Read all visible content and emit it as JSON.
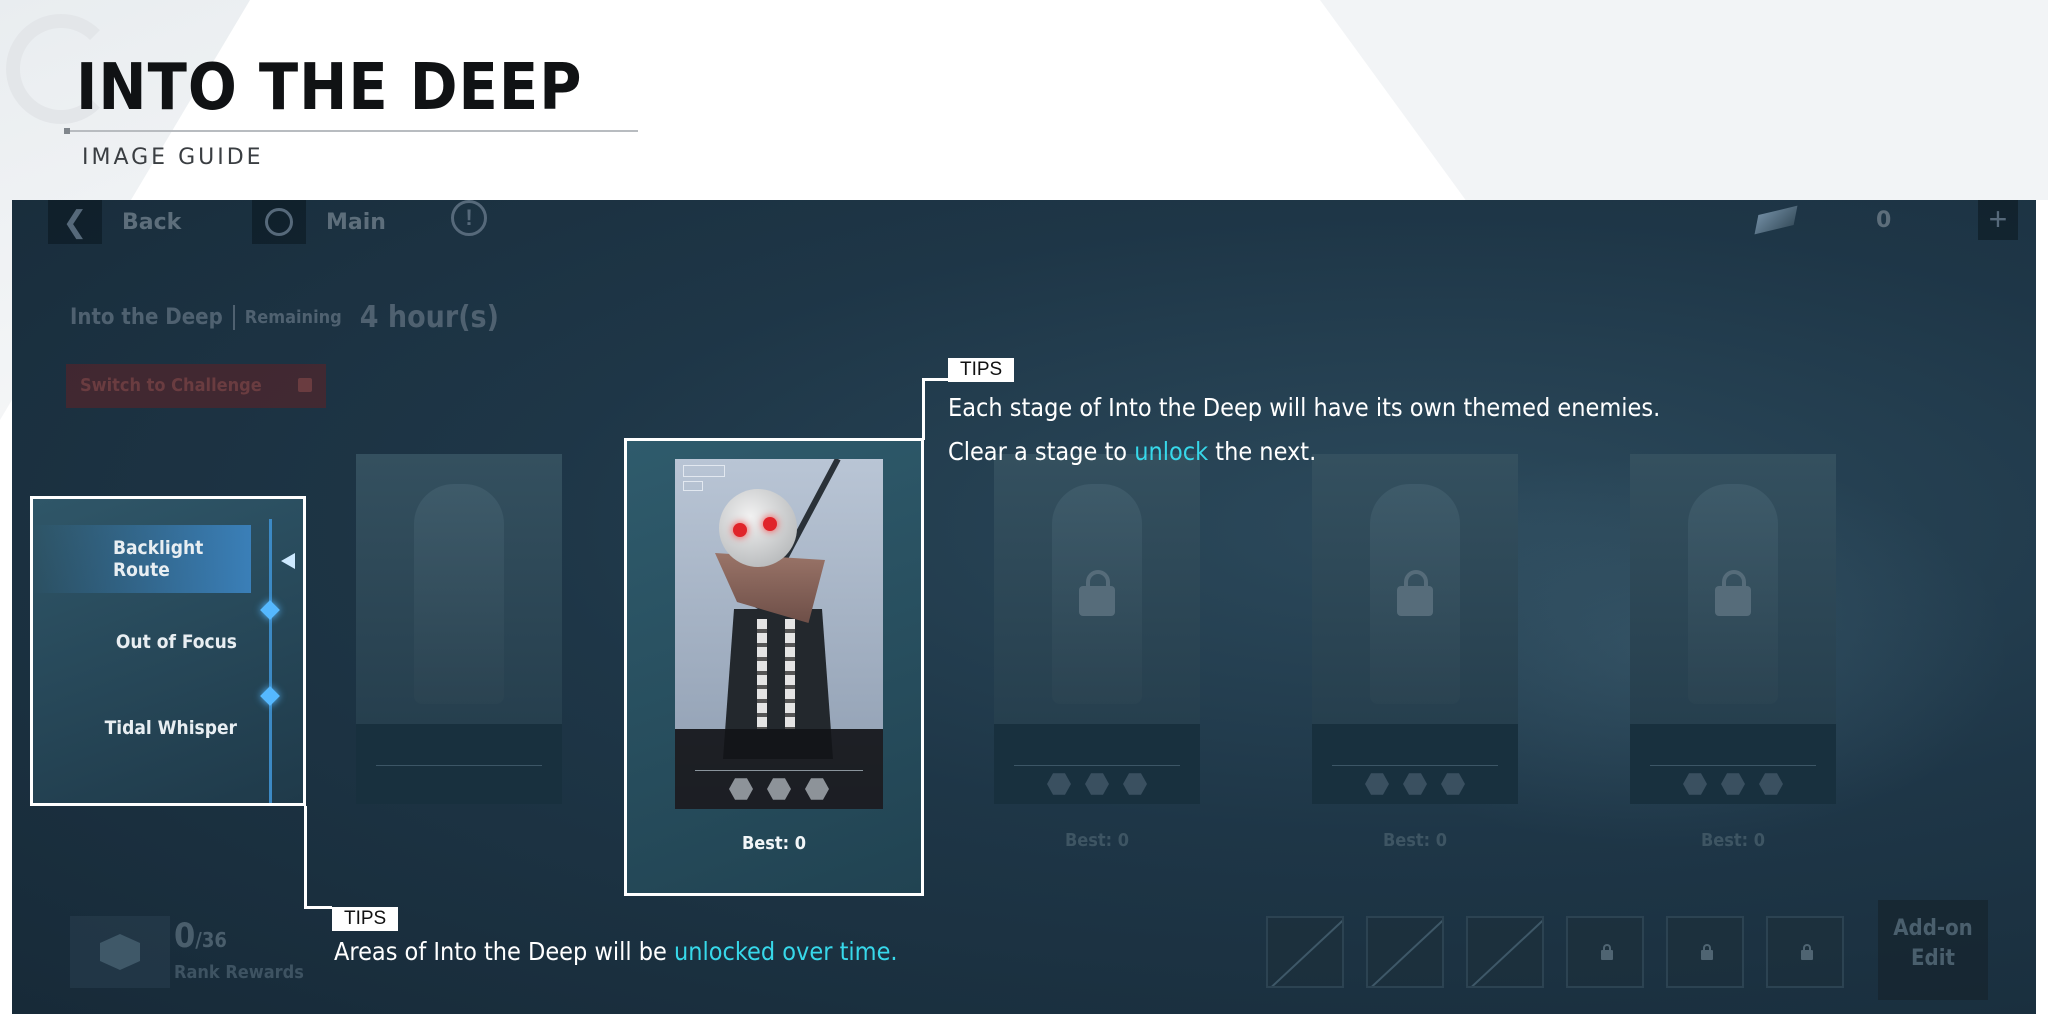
{
  "guide": {
    "title": "INTO THE DEEP",
    "subtitle": "IMAGE GUIDE"
  },
  "game_ui": {
    "back_label": "Back",
    "main_label": "Main",
    "info_icon": "info-icon",
    "currency_value": "0",
    "event_name": "Into the Deep",
    "remaining_label": "Remaining",
    "remaining_value": "4 hour(s)",
    "switch_button": "Switch to Challenge",
    "routes": [
      "Backlight Route",
      "Out of Focus",
      "Tidal Whisper"
    ],
    "active_route": "Backlight Route",
    "stages": [
      {
        "best": "",
        "locked": false
      },
      {
        "best": "Best: 0",
        "locked": false,
        "highlighted": true
      },
      {
        "best": "Best: 0",
        "locked": true
      },
      {
        "best": "Best: 0",
        "locked": true
      },
      {
        "best": "Best: 0",
        "locked": true
      }
    ],
    "rank": {
      "current": "0",
      "total": "/36",
      "label": "Rank Rewards"
    },
    "addon_label_1": "Add-on",
    "addon_label_2": "Edit",
    "colors": {
      "accent": "#37d8ea",
      "route_highlight": "#3a7fb8",
      "panel_bg": "#1e3647"
    }
  },
  "tips": [
    {
      "tag": "TIPS",
      "line1": "Each stage of Into the Deep will have its own themed enemies.",
      "line2_before": "Clear a stage to ",
      "line2_highlight": "unlock",
      "line2_after": " the next."
    },
    {
      "tag": "TIPS",
      "before": "Areas of Into the Deep will be ",
      "highlight": "unlocked over time."
    }
  ]
}
